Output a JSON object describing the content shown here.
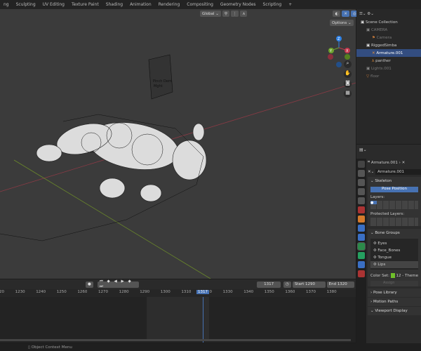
{
  "workspace_tabs": [
    "ng",
    "Sculpting",
    "UV Editing",
    "Texture Paint",
    "Shading",
    "Animation",
    "Rendering",
    "Compositing",
    "Geometry Nodes",
    "Scripting",
    "+"
  ],
  "viewport": {
    "transform_orientation": "Global",
    "options_label": "Options",
    "gizmo_axes": [
      "X",
      "Y",
      "Z"
    ],
    "axis_colors": {
      "x": "#c4384d",
      "y": "#6fa22e",
      "z": "#2f82e6"
    },
    "scene_sign": [
      "Pinch Dem",
      "Mght"
    ]
  },
  "outliner": {
    "items": [
      {
        "label": "Scene Collection",
        "indent": 0,
        "state": "normal"
      },
      {
        "label": "CAMERA",
        "indent": 1,
        "state": "dim"
      },
      {
        "label": "Camera",
        "indent": 2,
        "state": "dim"
      },
      {
        "label": "RiggedSimba",
        "indent": 1,
        "state": "normal"
      },
      {
        "label": "Armature.001",
        "indent": 2,
        "state": "selected"
      },
      {
        "label": "panther",
        "indent": 2,
        "state": "normal"
      },
      {
        "label": "Lights.001",
        "indent": 1,
        "state": "dim"
      },
      {
        "label": "floor",
        "indent": 1,
        "state": "dim"
      }
    ]
  },
  "properties": {
    "breadcrumb": "Armature.001",
    "data_name": "Armature.001",
    "skeleton": {
      "title": "Skeleton",
      "pose_position": "Pose Position",
      "layers_label": "Layers:",
      "protected_layers_label": "Protected Layers:"
    },
    "bone_groups": {
      "title": "Bone Groups",
      "items": [
        "Eyes",
        "Face_Bones",
        "Tongue",
        "Lips"
      ],
      "selected": "Lips",
      "color_set_label": "Color Set:",
      "color_set_value": "12 - Theme",
      "assign_label": "Assign"
    },
    "collapsed_panels": [
      "Pose Library",
      "Motion Paths"
    ],
    "viewport_display": "Viewport Display"
  },
  "timeline": {
    "current_frame": "1317",
    "start_label": "Start",
    "start": "1290",
    "end_label": "End",
    "end": "1320",
    "ruler": [
      "1220",
      "1230",
      "1240",
      "1250",
      "1260",
      "1270",
      "1280",
      "1290",
      "1300",
      "1310",
      "1320",
      "1330",
      "1340",
      "1350",
      "1360",
      "1370",
      "1380"
    ]
  },
  "status": {
    "context_menu": "Object Context Menu"
  }
}
